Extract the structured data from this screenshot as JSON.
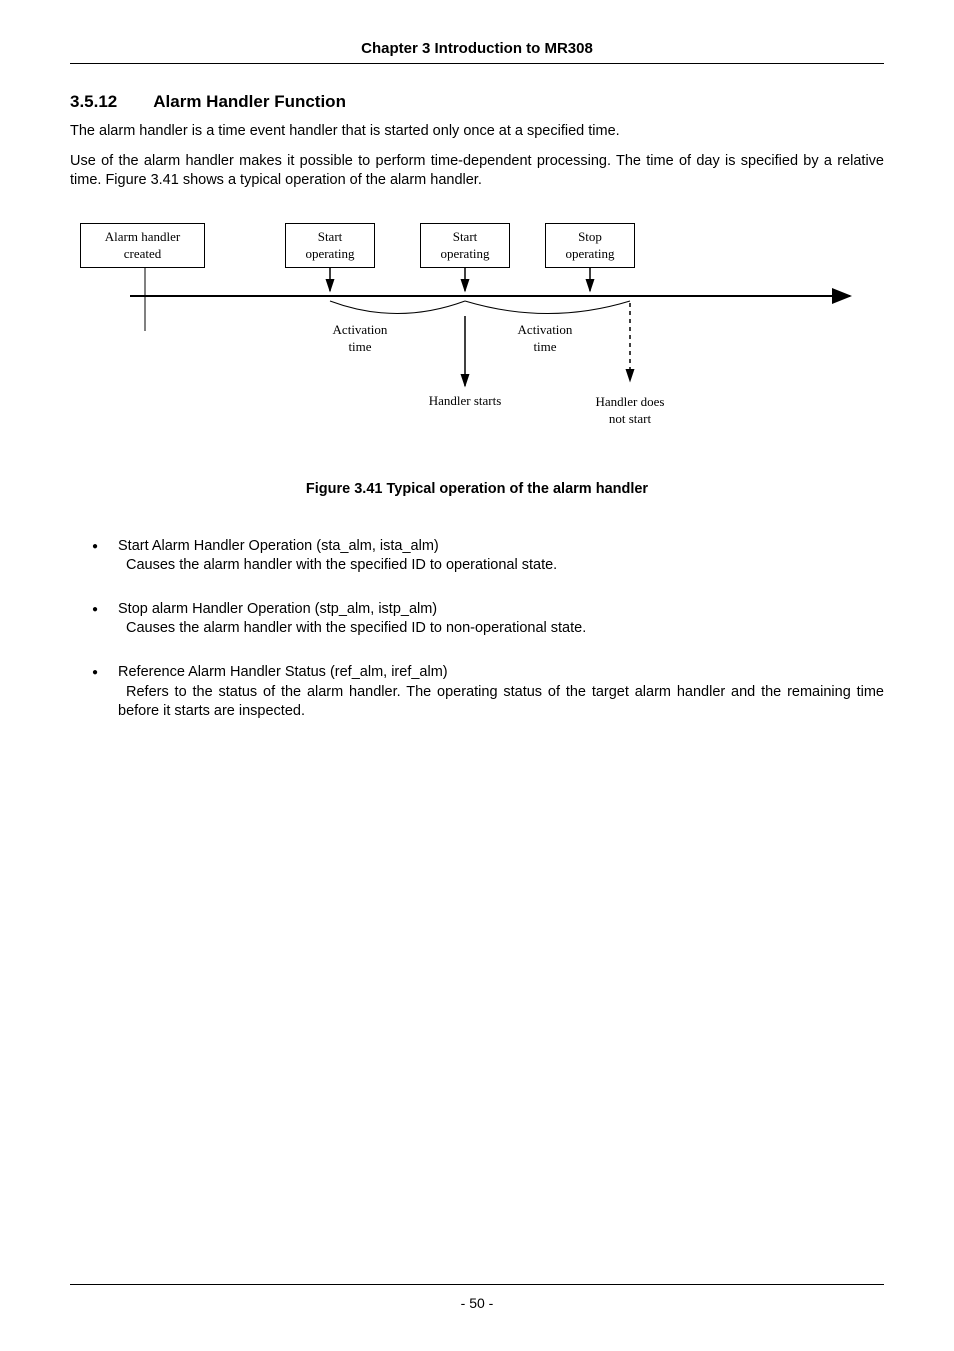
{
  "chapterHeader": "Chapter 3 Introduction to MR308",
  "section": {
    "number": "3.5.12",
    "title": "Alarm Handler Function"
  },
  "paragraphs": {
    "p1": "The alarm handler is a time event handler that is started only once at a specified time.",
    "p2": "Use of the alarm handler makes it possible to perform time-dependent processing. The time of day is specified by a relative time. Figure 3.41 shows a typical operation of the alarm handler."
  },
  "figure": {
    "box_created_l1": "Alarm handler",
    "box_created_l2": "created",
    "box_start1_l1": "Start",
    "box_start1_l2": "operating",
    "box_start2_l1": "Start",
    "box_start2_l2": "operating",
    "box_stop_l1": "Stop",
    "box_stop_l2": "operating",
    "activation1_l1": "Activation",
    "activation1_l2": "time",
    "activation2_l1": "Activation",
    "activation2_l2": "time",
    "handler_starts": "Handler starts",
    "handler_not_l1": "Handler does",
    "handler_not_l2": "not start",
    "caption": "Figure 3.41 Typical operation of the alarm handler"
  },
  "bullets": [
    {
      "title": "Start Alarm Handler Operation (sta_alm, ista_alm)",
      "desc": "Causes the alarm handler with the specified ID to operational state."
    },
    {
      "title": "Stop alarm Handler Operation (stp_alm, istp_alm)",
      "desc": "Causes the alarm handler with the specified ID to non-operational state."
    },
    {
      "title": "Reference Alarm Handler Status (ref_alm, iref_alm)",
      "desc": "Refers to the status of the alarm handler. The operating status of the target alarm handler and the remaining time before it starts are inspected."
    }
  ],
  "pageNumber": "- 50 -"
}
